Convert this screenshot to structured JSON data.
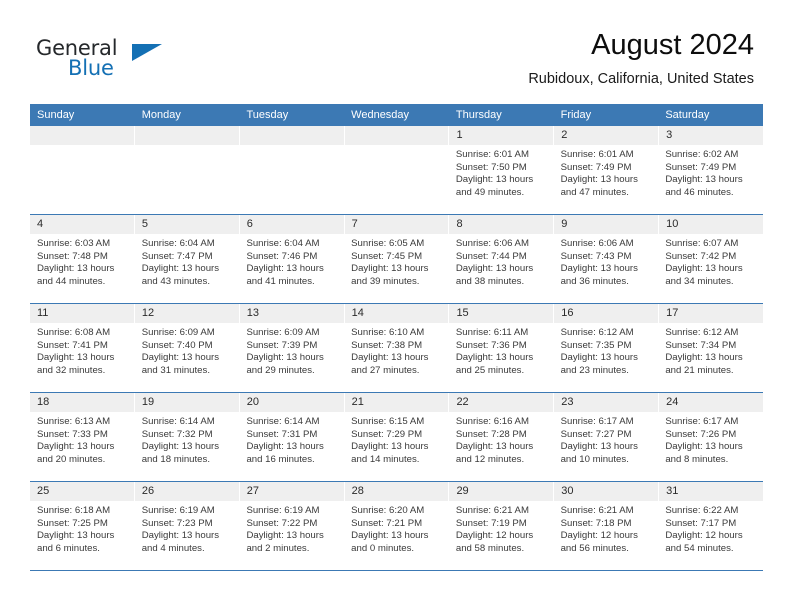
{
  "brand": {
    "name_part1": "General",
    "name_part2": "Blue",
    "accent_color": "#1470b4"
  },
  "header": {
    "month_title": "August 2024",
    "location": "Rubidoux, California, United States",
    "header_bg_color": "#3c79b4",
    "day_band_color": "#efefef"
  },
  "calendar": {
    "day_names": [
      "Sunday",
      "Monday",
      "Tuesday",
      "Wednesday",
      "Thursday",
      "Friday",
      "Saturday"
    ],
    "weeks": [
      [
        {
          "day": "",
          "lines": []
        },
        {
          "day": "",
          "lines": []
        },
        {
          "day": "",
          "lines": []
        },
        {
          "day": "",
          "lines": []
        },
        {
          "day": "1",
          "lines": [
            "Sunrise: 6:01 AM",
            "Sunset: 7:50 PM",
            "Daylight: 13 hours",
            "and 49 minutes."
          ]
        },
        {
          "day": "2",
          "lines": [
            "Sunrise: 6:01 AM",
            "Sunset: 7:49 PM",
            "Daylight: 13 hours",
            "and 47 minutes."
          ]
        },
        {
          "day": "3",
          "lines": [
            "Sunrise: 6:02 AM",
            "Sunset: 7:49 PM",
            "Daylight: 13 hours",
            "and 46 minutes."
          ]
        }
      ],
      [
        {
          "day": "4",
          "lines": [
            "Sunrise: 6:03 AM",
            "Sunset: 7:48 PM",
            "Daylight: 13 hours",
            "and 44 minutes."
          ]
        },
        {
          "day": "5",
          "lines": [
            "Sunrise: 6:04 AM",
            "Sunset: 7:47 PM",
            "Daylight: 13 hours",
            "and 43 minutes."
          ]
        },
        {
          "day": "6",
          "lines": [
            "Sunrise: 6:04 AM",
            "Sunset: 7:46 PM",
            "Daylight: 13 hours",
            "and 41 minutes."
          ]
        },
        {
          "day": "7",
          "lines": [
            "Sunrise: 6:05 AM",
            "Sunset: 7:45 PM",
            "Daylight: 13 hours",
            "and 39 minutes."
          ]
        },
        {
          "day": "8",
          "lines": [
            "Sunrise: 6:06 AM",
            "Sunset: 7:44 PM",
            "Daylight: 13 hours",
            "and 38 minutes."
          ]
        },
        {
          "day": "9",
          "lines": [
            "Sunrise: 6:06 AM",
            "Sunset: 7:43 PM",
            "Daylight: 13 hours",
            "and 36 minutes."
          ]
        },
        {
          "day": "10",
          "lines": [
            "Sunrise: 6:07 AM",
            "Sunset: 7:42 PM",
            "Daylight: 13 hours",
            "and 34 minutes."
          ]
        }
      ],
      [
        {
          "day": "11",
          "lines": [
            "Sunrise: 6:08 AM",
            "Sunset: 7:41 PM",
            "Daylight: 13 hours",
            "and 32 minutes."
          ]
        },
        {
          "day": "12",
          "lines": [
            "Sunrise: 6:09 AM",
            "Sunset: 7:40 PM",
            "Daylight: 13 hours",
            "and 31 minutes."
          ]
        },
        {
          "day": "13",
          "lines": [
            "Sunrise: 6:09 AM",
            "Sunset: 7:39 PM",
            "Daylight: 13 hours",
            "and 29 minutes."
          ]
        },
        {
          "day": "14",
          "lines": [
            "Sunrise: 6:10 AM",
            "Sunset: 7:38 PM",
            "Daylight: 13 hours",
            "and 27 minutes."
          ]
        },
        {
          "day": "15",
          "lines": [
            "Sunrise: 6:11 AM",
            "Sunset: 7:36 PM",
            "Daylight: 13 hours",
            "and 25 minutes."
          ]
        },
        {
          "day": "16",
          "lines": [
            "Sunrise: 6:12 AM",
            "Sunset: 7:35 PM",
            "Daylight: 13 hours",
            "and 23 minutes."
          ]
        },
        {
          "day": "17",
          "lines": [
            "Sunrise: 6:12 AM",
            "Sunset: 7:34 PM",
            "Daylight: 13 hours",
            "and 21 minutes."
          ]
        }
      ],
      [
        {
          "day": "18",
          "lines": [
            "Sunrise: 6:13 AM",
            "Sunset: 7:33 PM",
            "Daylight: 13 hours",
            "and 20 minutes."
          ]
        },
        {
          "day": "19",
          "lines": [
            "Sunrise: 6:14 AM",
            "Sunset: 7:32 PM",
            "Daylight: 13 hours",
            "and 18 minutes."
          ]
        },
        {
          "day": "20",
          "lines": [
            "Sunrise: 6:14 AM",
            "Sunset: 7:31 PM",
            "Daylight: 13 hours",
            "and 16 minutes."
          ]
        },
        {
          "day": "21",
          "lines": [
            "Sunrise: 6:15 AM",
            "Sunset: 7:29 PM",
            "Daylight: 13 hours",
            "and 14 minutes."
          ]
        },
        {
          "day": "22",
          "lines": [
            "Sunrise: 6:16 AM",
            "Sunset: 7:28 PM",
            "Daylight: 13 hours",
            "and 12 minutes."
          ]
        },
        {
          "day": "23",
          "lines": [
            "Sunrise: 6:17 AM",
            "Sunset: 7:27 PM",
            "Daylight: 13 hours",
            "and 10 minutes."
          ]
        },
        {
          "day": "24",
          "lines": [
            "Sunrise: 6:17 AM",
            "Sunset: 7:26 PM",
            "Daylight: 13 hours",
            "and 8 minutes."
          ]
        }
      ],
      [
        {
          "day": "25",
          "lines": [
            "Sunrise: 6:18 AM",
            "Sunset: 7:25 PM",
            "Daylight: 13 hours",
            "and 6 minutes."
          ]
        },
        {
          "day": "26",
          "lines": [
            "Sunrise: 6:19 AM",
            "Sunset: 7:23 PM",
            "Daylight: 13 hours",
            "and 4 minutes."
          ]
        },
        {
          "day": "27",
          "lines": [
            "Sunrise: 6:19 AM",
            "Sunset: 7:22 PM",
            "Daylight: 13 hours",
            "and 2 minutes."
          ]
        },
        {
          "day": "28",
          "lines": [
            "Sunrise: 6:20 AM",
            "Sunset: 7:21 PM",
            "Daylight: 13 hours",
            "and 0 minutes."
          ]
        },
        {
          "day": "29",
          "lines": [
            "Sunrise: 6:21 AM",
            "Sunset: 7:19 PM",
            "Daylight: 12 hours",
            "and 58 minutes."
          ]
        },
        {
          "day": "30",
          "lines": [
            "Sunrise: 6:21 AM",
            "Sunset: 7:18 PM",
            "Daylight: 12 hours",
            "and 56 minutes."
          ]
        },
        {
          "day": "31",
          "lines": [
            "Sunrise: 6:22 AM",
            "Sunset: 7:17 PM",
            "Daylight: 12 hours",
            "and 54 minutes."
          ]
        }
      ]
    ]
  }
}
